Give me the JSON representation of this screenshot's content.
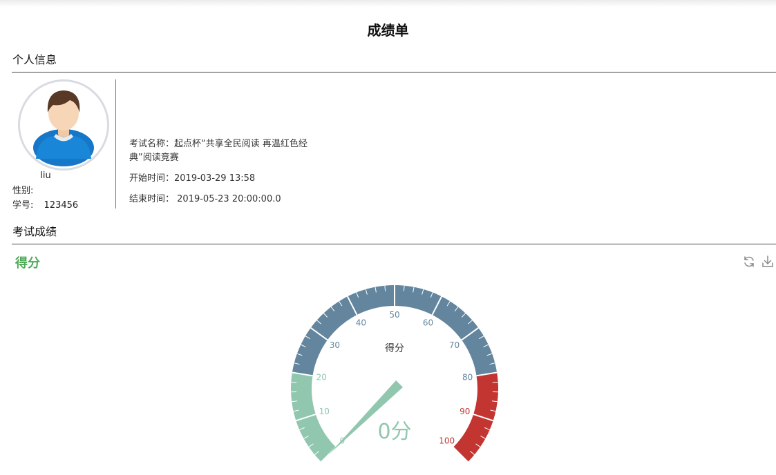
{
  "page": {
    "title": "成绩单"
  },
  "sections": {
    "personal": "个人信息",
    "scores": "考试成绩"
  },
  "personal": {
    "username": "liu",
    "gender_label": "性别:",
    "student_id_label": "学号:",
    "student_id": "123456"
  },
  "exam": {
    "name_label": "考试名称：",
    "name_value": "起点杯“共享全民阅读 再温红色经典”阅读竞赛",
    "start_label": "开始时间：",
    "start_value": "2019-03-29 13:58",
    "end_label": "结束时间：",
    "end_value": " 2019-05-23 20:00:00.0"
  },
  "score_panel": {
    "title": "得分",
    "tools": {
      "refresh": "refresh-icon",
      "download": "download-icon"
    }
  },
  "chart_data": {
    "type": "gauge",
    "title": "得分",
    "min": 0,
    "max": 100,
    "value": 0,
    "value_text": "0分",
    "tick_labels": [
      "0",
      "10",
      "20",
      "30",
      "40",
      "50",
      "60",
      "70",
      "80",
      "90",
      "100"
    ],
    "bands": [
      {
        "to": 0.2,
        "color": "#91c7ae"
      },
      {
        "to": 0.8,
        "color": "#63869e"
      },
      {
        "to": 1.0,
        "color": "#c23531"
      }
    ],
    "pointer_color": "#91c7ae"
  }
}
